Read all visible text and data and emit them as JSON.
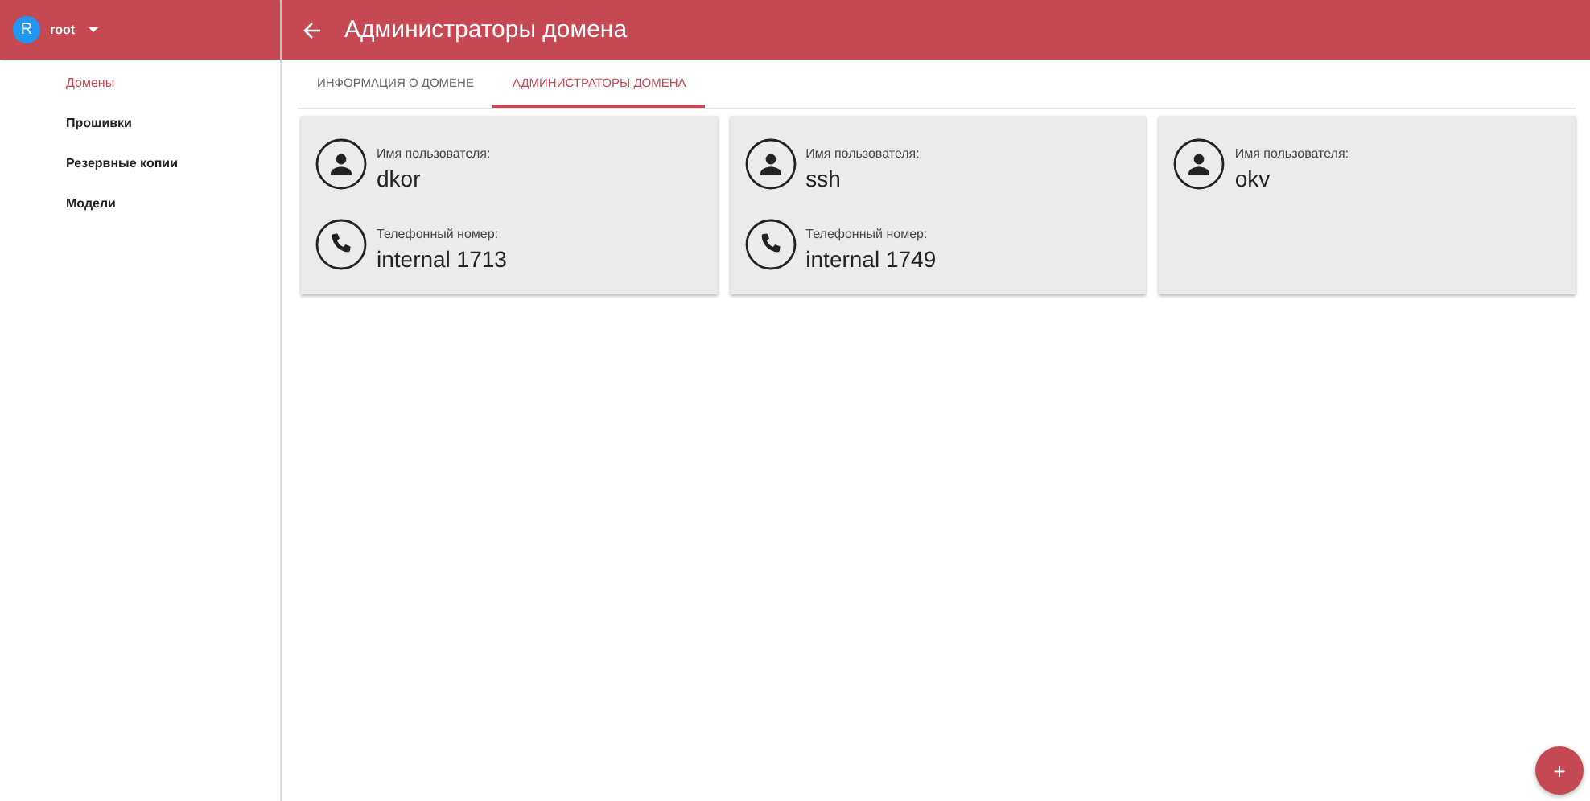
{
  "account": {
    "initial": "R",
    "name": "root"
  },
  "sidebar": {
    "items": [
      {
        "label": "Домены",
        "selected": true
      },
      {
        "label": "Прошивки",
        "selected": false
      },
      {
        "label": "Резервные копии",
        "selected": false
      },
      {
        "label": "Модели",
        "selected": false
      }
    ]
  },
  "header": {
    "title": "Администраторы домена"
  },
  "tabs": [
    {
      "label": "ИНФОРМАЦИЯ О ДОМЕНЕ",
      "selected": false
    },
    {
      "label": "АДМИНИСТРАТОРЫ ДОМЕНА",
      "selected": true
    }
  ],
  "cards": [
    {
      "fields": [
        {
          "kind": "user",
          "label": "Имя пользователя:",
          "value": "dkor"
        },
        {
          "kind": "phone",
          "label": "Телефонный номер:",
          "value": "internal 1713"
        }
      ]
    },
    {
      "fields": [
        {
          "kind": "user",
          "label": "Имя пользователя:",
          "value": "ssh"
        },
        {
          "kind": "phone",
          "label": "Телефонный номер:",
          "value": "internal 1749"
        }
      ]
    },
    {
      "fields": [
        {
          "kind": "user",
          "label": "Имя пользователя:",
          "value": "okv"
        }
      ]
    }
  ],
  "fab": {
    "label": "+"
  }
}
